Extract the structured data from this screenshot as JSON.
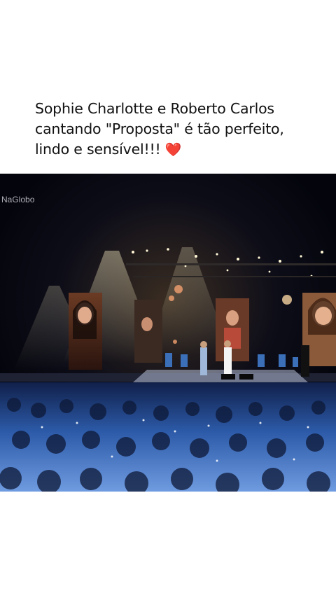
{
  "caption": {
    "line1": "Sophie Charlotte e Roberto Carlos",
    "line2": "cantando \"Proposta\" é tão perfeito,",
    "line3": "lindo e sensível!!!",
    "heart": "❤️"
  },
  "video": {
    "watermark": "NaGlobo",
    "heart_icon": "heart-icon",
    "accent_blue": "#4a7fd8",
    "stage_warm": "#f3b26a"
  }
}
